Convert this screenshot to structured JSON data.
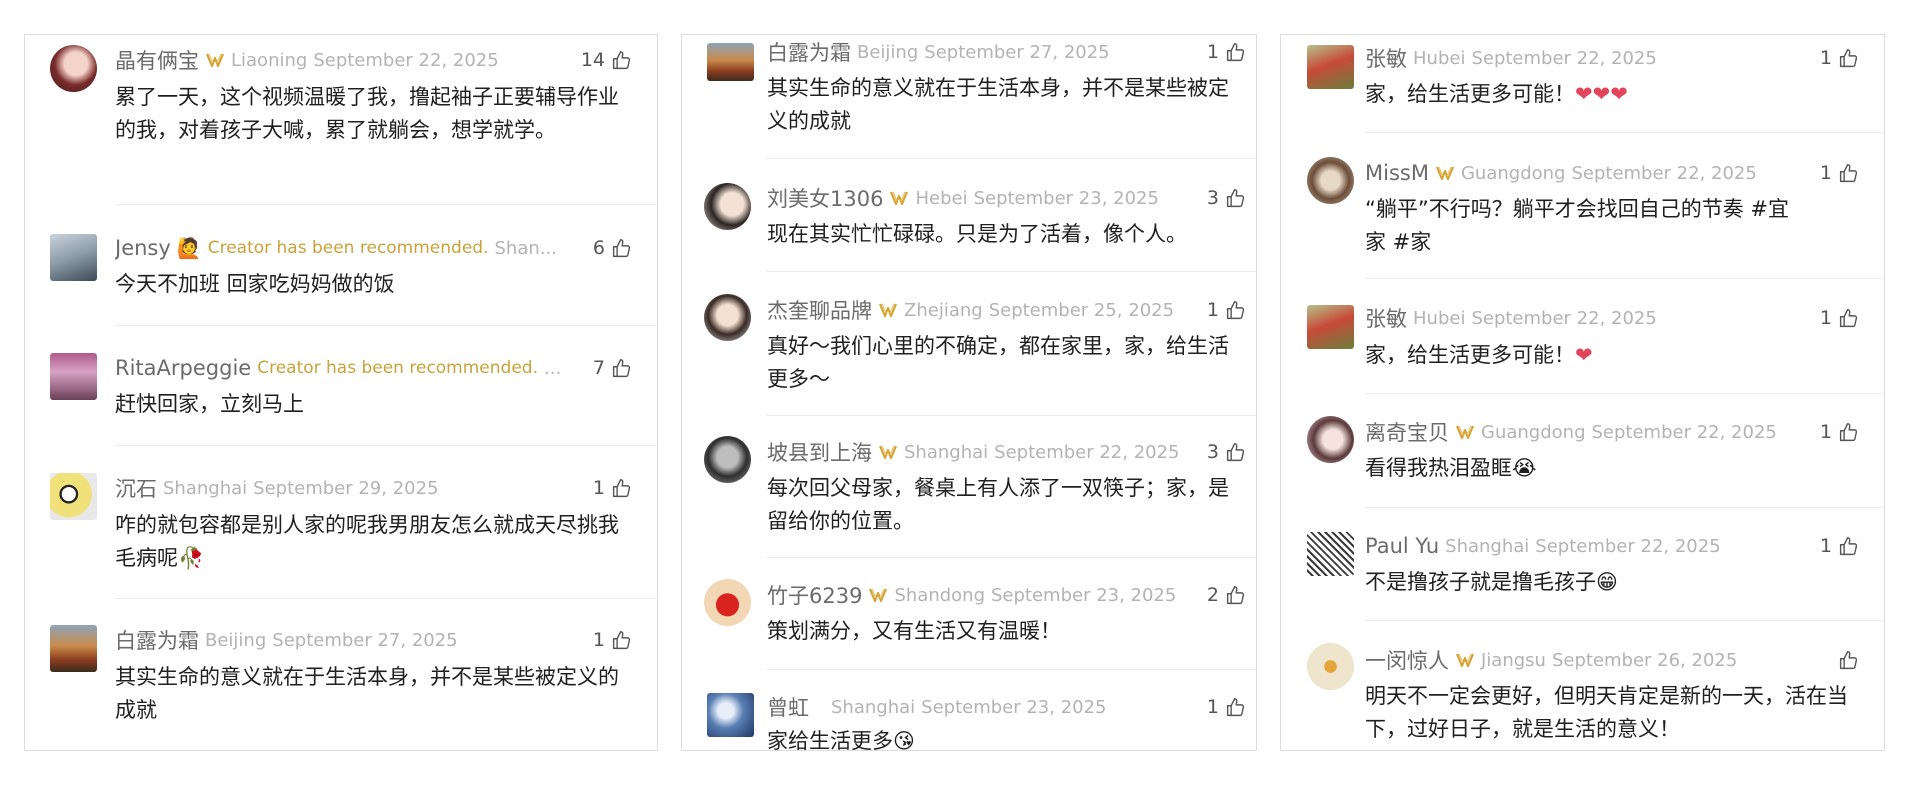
{
  "panel1": [
    {
      "name": "晶有俩宝",
      "vip": true,
      "location": "Liaoning",
      "date": "September 22, 2025",
      "likes": "14",
      "text": "累了一天，这个视频温暖了我，撸起袖子正要辅导作业的我，对着孩子大喊，累了就躺会，想学就学。",
      "avatar": "avatar-woman-flowers"
    },
    {
      "name": "Jensy",
      "badge": "🙋",
      "recommended": "Creator has been recommended.",
      "location": "Shan...",
      "likes": "6",
      "text": "今天不加班 回家吃妈妈做的饭",
      "avatar": "avatar-man-photo"
    },
    {
      "name": "RitaArpeggie",
      "recommended": "Creator has been recommended.",
      "location": "...",
      "likes": "7",
      "text": "赶快回家，立刻马上",
      "avatar": "avatar-pink-drink"
    },
    {
      "name": "沉石",
      "location": "Shanghai",
      "date": "September 29, 2025",
      "likes": "1",
      "text": "咋的就包容都是别人家的呢我男朋友怎么就成天尽挑我毛病呢🥀",
      "avatar": "avatar-cartoon"
    },
    {
      "name": "白露为霜",
      "location": "Beijing",
      "date": "September 27, 2025",
      "likes": "1",
      "text": "其实生命的意义就在于生活本身，并不是某些被定义的成就",
      "avatar": "avatar-autumn-landscape"
    }
  ],
  "panel2": [
    {
      "name": "白露为霜",
      "location": "Beijing",
      "date": "September 27, 2025",
      "likes": "1",
      "text": "其实生命的意义就在于生活本身，并不是某些被定义的成就",
      "avatar": "avatar-autumn-landscape"
    },
    {
      "name": "刘美女1306",
      "vip": true,
      "location": "Hebei",
      "date": "September 23, 2025",
      "likes": "3",
      "text": "现在其实忙忙碌碌。只是为了活着，像个人。",
      "avatar": "avatar-woman-portrait"
    },
    {
      "name": "杰奎聊品牌",
      "vip": true,
      "location": "Zhejiang",
      "date": "September 25, 2025",
      "likes": "1",
      "text": "真好～我们心里的不确定，都在家里，家，给生活更多～",
      "avatar": "avatar-woman-smile"
    },
    {
      "name": "坡县到上海",
      "vip": true,
      "location": "Shanghai",
      "date": "September 22, 2025",
      "likes": "3",
      "text": "每次回父母家，餐桌上有人添了一双筷子；家，是留给你的位置。",
      "avatar": "avatar-man-bw"
    },
    {
      "name": "竹子6239",
      "vip": true,
      "location": "Shandong",
      "date": "September 23, 2025",
      "likes": "2",
      "text": "策划满分，又有生活又有温暖！",
      "avatar": "avatar-apple"
    },
    {
      "name": "曾虹",
      "location": "Shanghai",
      "date": "September 23, 2025",
      "likes": "1",
      "text": "家给生活更多😘",
      "avatar": "avatar-blue-art"
    }
  ],
  "panel3": [
    {
      "name": "张敏",
      "location": "Hubei",
      "date": "September 22, 2025",
      "likes": "1",
      "text": "家，给生活更多可能！",
      "hearts": "❤❤❤",
      "avatar": "avatar-cap-outdoor"
    },
    {
      "name": "MissM",
      "vip": true,
      "location": "Guangdong",
      "date": "September 22, 2025",
      "likes": "1",
      "text": "“躺平”不行吗？躺平才会找回自己的节奏 #宜家 #家",
      "avatar": "avatar-monkey"
    },
    {
      "name": "张敏",
      "location": "Hubei",
      "date": "September 22, 2025",
      "likes": "1",
      "text": "家，给生活更多可能！",
      "hearts": "❤",
      "avatar": "avatar-cap-outdoor"
    },
    {
      "name": "离奇宝贝",
      "vip": true,
      "location": "Guangdong",
      "date": "September 22, 2025",
      "likes": "1",
      "text": "看得我热泪盈眶😭",
      "avatar": "avatar-girl-pink"
    },
    {
      "name": "Paul Yu",
      "location": "Shanghai",
      "date": "September 22, 2025",
      "likes": "1",
      "text": "不是撸孩子就是撸毛孩子😁",
      "avatar": "avatar-sketch-glasses"
    },
    {
      "name": "一闵惊人",
      "vip": true,
      "location": "Jiangsu",
      "date": "September 26, 2025",
      "likes": "",
      "text": "明天不一定会更好，但明天肯定是新的一天，活在当下，过好日子，就是生活的意义！",
      "avatar": "avatar-calligraphy"
    }
  ]
}
